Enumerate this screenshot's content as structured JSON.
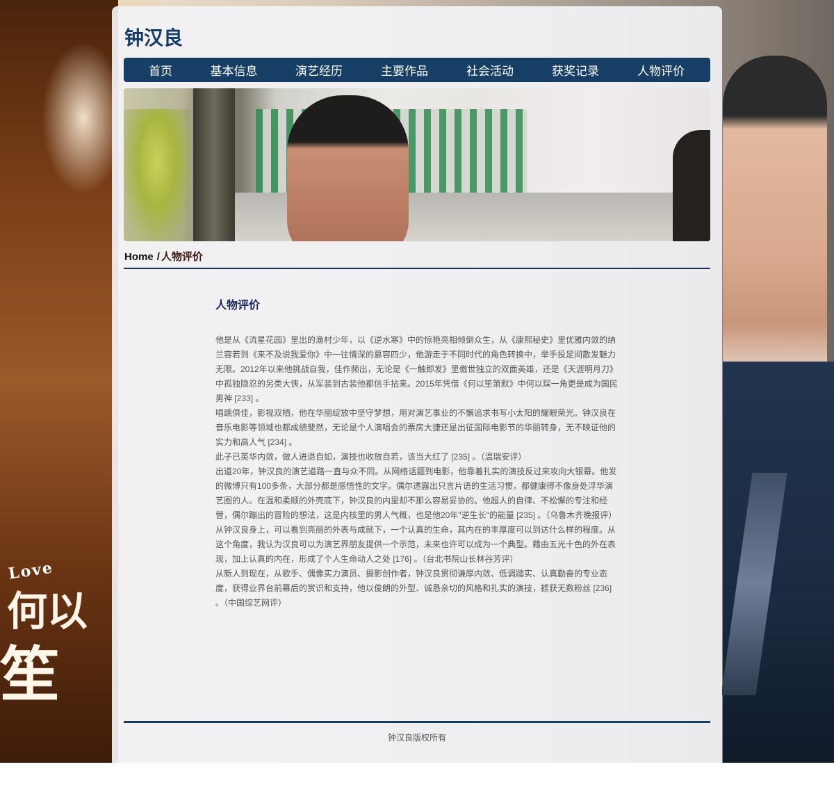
{
  "site": {
    "title": "钟汉良"
  },
  "nav": {
    "items": [
      {
        "label": "首页"
      },
      {
        "label": "基本信息"
      },
      {
        "label": "演艺经历"
      },
      {
        "label": "主要作品"
      },
      {
        "label": "社会活动"
      },
      {
        "label": "获奖记录"
      },
      {
        "label": "人物评价"
      }
    ]
  },
  "background": {
    "love_text": "Love",
    "poster_text_1": "何以",
    "poster_text_2": "笙箫默"
  },
  "breadcrumb": {
    "home": "Home",
    "separator": "/",
    "current": "人物评价"
  },
  "content": {
    "heading": "人物评价",
    "paragraphs": [
      "他是从《流星花园》里出的渔村少年，以《逆水寒》中的惊艳亮相倾倒众生，从《康熙秘史》里优雅内敛的纳兰容若到《来不及说我爱你》中一往情深的慕容四少，他游走于不同时代的角色转换中，举手投足间散发魅力无限。2012年以来他挑战自我，佳作频出，无论是《一触即发》里傲世独立的双面英雄，还是《天涯明月刀》中孤独隐忍的另类大侠，从军装到古装他都信手拈来。2015年凭借《何以笙箫默》中何以琛一角更是成为国民男神 [233] 。",
      "唱跳俱佳，影视双栖，他在华丽绽放中坚守梦想，用对演艺事业的不懈追求书写小太阳的耀眼荣光。钟汉良在音乐电影等领域也都成绩斐然，无论是个人演唱会的票房大捷还是出征国际电影节的华丽转身，无不映证他的实力和高人气 [234] 。",
      "此子已英华内敛，做人进退自如，演技也收放自若，该当大红了 [235] 。（温瑞安评）",
      "出道20年，钟汉良的演艺道路一直与众不同。从网络话题到电影，他靠着扎实的演技反过来攻向大银幕。他发的微博只有100多条，大部分都是感悟性的文字。偶尔透露出只言片语的生活习惯，都健康得不像身处浮华演艺圈的人。在温和柔顺的外壳底下，钟汉良的内里却不那么容易妥协的。他超人的自律、不松懈的专注和经营，偶尔蹦出的冒险的想法，这是内核里的男人气概，也是他20年\"逆生长\"的能量 [235] 。（乌鲁木齐晚报评）",
      "从钟汉良身上，可以看到亮丽的外表与成就下，一个认真的生命，其内在的丰厚度可以到达什么样的程度。从这个角度，我认为汉良可以为演艺界朋友提供一个示范，未来也许可以成为一个典型。藉由五光十色的外在表现，加上认真的内在，形成了个人生命动人之处 [176] 。（台北书院山长林谷芳评）",
      "从新人到现在，从歌手、偶像实力演员、摄影创作者，钟汉良贯彻谦厚内敛、低调踏实、认真勤奋的专业态度，获得业界台前幕后的赏识和支持，他以俊朗的外型、诚恳亲切的风格和扎实的演技，掳获无数粉丝 [236] 。（中国综艺网评）"
    ]
  },
  "footer": {
    "copyright": "钟汉良版权所有"
  }
}
